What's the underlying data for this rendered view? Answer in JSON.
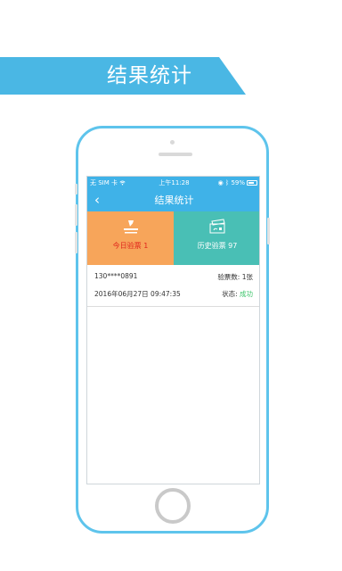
{
  "banner": {
    "title": "结果统计"
  },
  "statusbar": {
    "carrier": "无 SIM 卡",
    "time": "上午11:28",
    "battery": "59%"
  },
  "navbar": {
    "back": "‹",
    "title": "结果统计"
  },
  "tiles": {
    "today": {
      "label": "今日验票 1",
      "icon": "ticket-check-icon"
    },
    "history": {
      "label": "历史验票 97",
      "icon": "ticket-history-icon"
    }
  },
  "record": {
    "phone": "130****0891",
    "count": "验票数: 1张",
    "datetime": "2016年06月27日 09:47:35",
    "status_label": "状态:",
    "status_value": "成功"
  },
  "colors": {
    "accent": "#3fb2e8",
    "today_tile": "#f7a55a",
    "history_tile": "#49bfb5",
    "success": "#3cc46a"
  }
}
